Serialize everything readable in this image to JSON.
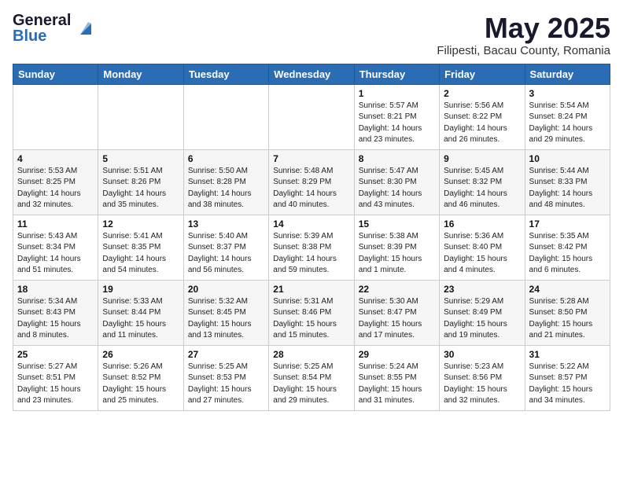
{
  "header": {
    "logo_general": "General",
    "logo_blue": "Blue",
    "title": "May 2025",
    "subtitle": "Filipesti, Bacau County, Romania"
  },
  "calendar": {
    "days_of_week": [
      "Sunday",
      "Monday",
      "Tuesday",
      "Wednesday",
      "Thursday",
      "Friday",
      "Saturday"
    ],
    "weeks": [
      [
        {
          "num": "",
          "info": ""
        },
        {
          "num": "",
          "info": ""
        },
        {
          "num": "",
          "info": ""
        },
        {
          "num": "",
          "info": ""
        },
        {
          "num": "1",
          "info": "Sunrise: 5:57 AM\nSunset: 8:21 PM\nDaylight: 14 hours\nand 23 minutes."
        },
        {
          "num": "2",
          "info": "Sunrise: 5:56 AM\nSunset: 8:22 PM\nDaylight: 14 hours\nand 26 minutes."
        },
        {
          "num": "3",
          "info": "Sunrise: 5:54 AM\nSunset: 8:24 PM\nDaylight: 14 hours\nand 29 minutes."
        }
      ],
      [
        {
          "num": "4",
          "info": "Sunrise: 5:53 AM\nSunset: 8:25 PM\nDaylight: 14 hours\nand 32 minutes."
        },
        {
          "num": "5",
          "info": "Sunrise: 5:51 AM\nSunset: 8:26 PM\nDaylight: 14 hours\nand 35 minutes."
        },
        {
          "num": "6",
          "info": "Sunrise: 5:50 AM\nSunset: 8:28 PM\nDaylight: 14 hours\nand 38 minutes."
        },
        {
          "num": "7",
          "info": "Sunrise: 5:48 AM\nSunset: 8:29 PM\nDaylight: 14 hours\nand 40 minutes."
        },
        {
          "num": "8",
          "info": "Sunrise: 5:47 AM\nSunset: 8:30 PM\nDaylight: 14 hours\nand 43 minutes."
        },
        {
          "num": "9",
          "info": "Sunrise: 5:45 AM\nSunset: 8:32 PM\nDaylight: 14 hours\nand 46 minutes."
        },
        {
          "num": "10",
          "info": "Sunrise: 5:44 AM\nSunset: 8:33 PM\nDaylight: 14 hours\nand 48 minutes."
        }
      ],
      [
        {
          "num": "11",
          "info": "Sunrise: 5:43 AM\nSunset: 8:34 PM\nDaylight: 14 hours\nand 51 minutes."
        },
        {
          "num": "12",
          "info": "Sunrise: 5:41 AM\nSunset: 8:35 PM\nDaylight: 14 hours\nand 54 minutes."
        },
        {
          "num": "13",
          "info": "Sunrise: 5:40 AM\nSunset: 8:37 PM\nDaylight: 14 hours\nand 56 minutes."
        },
        {
          "num": "14",
          "info": "Sunrise: 5:39 AM\nSunset: 8:38 PM\nDaylight: 14 hours\nand 59 minutes."
        },
        {
          "num": "15",
          "info": "Sunrise: 5:38 AM\nSunset: 8:39 PM\nDaylight: 15 hours\nand 1 minute."
        },
        {
          "num": "16",
          "info": "Sunrise: 5:36 AM\nSunset: 8:40 PM\nDaylight: 15 hours\nand 4 minutes."
        },
        {
          "num": "17",
          "info": "Sunrise: 5:35 AM\nSunset: 8:42 PM\nDaylight: 15 hours\nand 6 minutes."
        }
      ],
      [
        {
          "num": "18",
          "info": "Sunrise: 5:34 AM\nSunset: 8:43 PM\nDaylight: 15 hours\nand 8 minutes."
        },
        {
          "num": "19",
          "info": "Sunrise: 5:33 AM\nSunset: 8:44 PM\nDaylight: 15 hours\nand 11 minutes."
        },
        {
          "num": "20",
          "info": "Sunrise: 5:32 AM\nSunset: 8:45 PM\nDaylight: 15 hours\nand 13 minutes."
        },
        {
          "num": "21",
          "info": "Sunrise: 5:31 AM\nSunset: 8:46 PM\nDaylight: 15 hours\nand 15 minutes."
        },
        {
          "num": "22",
          "info": "Sunrise: 5:30 AM\nSunset: 8:47 PM\nDaylight: 15 hours\nand 17 minutes."
        },
        {
          "num": "23",
          "info": "Sunrise: 5:29 AM\nSunset: 8:49 PM\nDaylight: 15 hours\nand 19 minutes."
        },
        {
          "num": "24",
          "info": "Sunrise: 5:28 AM\nSunset: 8:50 PM\nDaylight: 15 hours\nand 21 minutes."
        }
      ],
      [
        {
          "num": "25",
          "info": "Sunrise: 5:27 AM\nSunset: 8:51 PM\nDaylight: 15 hours\nand 23 minutes."
        },
        {
          "num": "26",
          "info": "Sunrise: 5:26 AM\nSunset: 8:52 PM\nDaylight: 15 hours\nand 25 minutes."
        },
        {
          "num": "27",
          "info": "Sunrise: 5:25 AM\nSunset: 8:53 PM\nDaylight: 15 hours\nand 27 minutes."
        },
        {
          "num": "28",
          "info": "Sunrise: 5:25 AM\nSunset: 8:54 PM\nDaylight: 15 hours\nand 29 minutes."
        },
        {
          "num": "29",
          "info": "Sunrise: 5:24 AM\nSunset: 8:55 PM\nDaylight: 15 hours\nand 31 minutes."
        },
        {
          "num": "30",
          "info": "Sunrise: 5:23 AM\nSunset: 8:56 PM\nDaylight: 15 hours\nand 32 minutes."
        },
        {
          "num": "31",
          "info": "Sunrise: 5:22 AM\nSunset: 8:57 PM\nDaylight: 15 hours\nand 34 minutes."
        }
      ]
    ]
  }
}
